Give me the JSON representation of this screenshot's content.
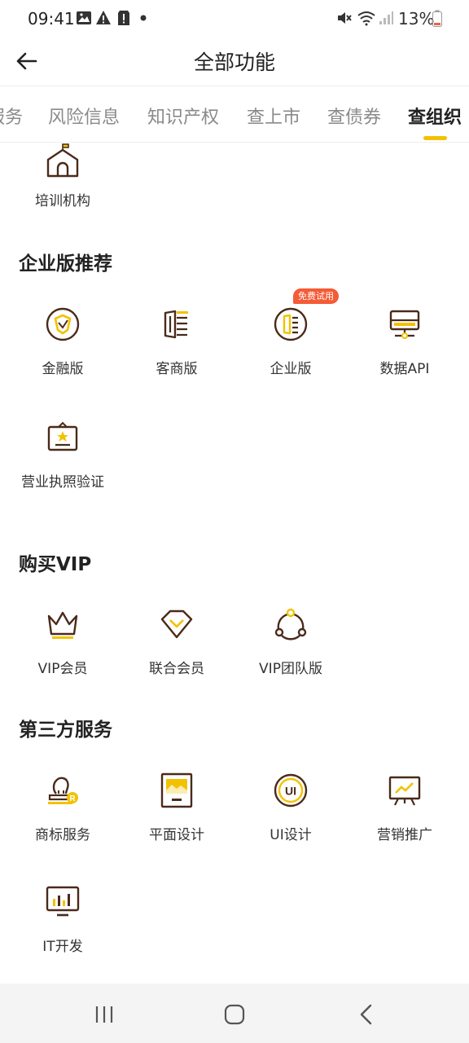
{
  "status": {
    "time": "09:41",
    "battery": "13%"
  },
  "header": {
    "title": "全部功能"
  },
  "tabs": [
    "服务",
    "风险信息",
    "知识产权",
    "查上市",
    "查债券",
    "查组织"
  ],
  "sections": {
    "top_item": {
      "label": "培训机构",
      "icon": "institution-icon"
    },
    "enterprise": {
      "title": "企业版推荐",
      "badge": "免费试用",
      "items": [
        {
          "label": "金融版",
          "icon": "shield-icon"
        },
        {
          "label": "客商版",
          "icon": "merchant-icon"
        },
        {
          "label": "企业版",
          "icon": "enterprise-icon"
        },
        {
          "label": "数据API",
          "icon": "server-icon"
        },
        {
          "label": "营业执照验证",
          "icon": "license-icon"
        }
      ]
    },
    "vip": {
      "title": "购买VIP",
      "items": [
        {
          "label": "VIP会员",
          "icon": "crown-icon"
        },
        {
          "label": "联合会员",
          "icon": "diamond-icon"
        },
        {
          "label": "VIP团队版",
          "icon": "team-icon"
        }
      ]
    },
    "third_party": {
      "title": "第三方服务",
      "items": [
        {
          "label": "商标服务",
          "icon": "stamp-icon"
        },
        {
          "label": "平面设计",
          "icon": "image-frame-icon"
        },
        {
          "label": "UI设计",
          "icon": "ui-circle-icon"
        },
        {
          "label": "营销推广",
          "icon": "presentation-icon"
        },
        {
          "label": "IT开发",
          "icon": "monitor-chart-icon"
        }
      ]
    }
  },
  "colors": {
    "accent": "#f2c200",
    "icon_stroke": "#4a2a1a",
    "badge": "#f45b36"
  }
}
